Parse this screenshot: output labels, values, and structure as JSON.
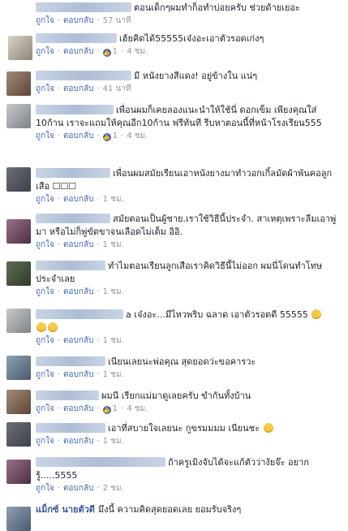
{
  "comments": [
    {
      "text": "ตอนเด็กๆผมทำก็อทำบ่อยครับ ช่วยด้ายเยอะ",
      "like": "ถูกใจ",
      "reply": "ตอบกลับ",
      "reactions": "",
      "time": "57 นาที"
    },
    {
      "text": "เฮ้ยคิดได้55555เจ๋งอะเอาตัวรอดเก่งๆ",
      "like": "ถูกใจ",
      "reply": "ตอบกลับ",
      "reactions": "1",
      "time": "4 ชม."
    },
    {
      "text": "มี หนังยางสีแดง! อยู่ข้างใน แน่ๆ",
      "like": "ถูกใจ",
      "reply": "ตอบกลับ",
      "reactions": "",
      "time": "41 นาที"
    },
    {
      "text": "เพื่อนผมก็เคยลองแนะนำให้ใช้นี่ ดอกเข็ม เพียงคุณใส่ 10ก้าน เราจะแถมให้คุณอีก10ก้าน ฟรีทันที รีบหาตอนนี้ที่หน้าโรงเรียน555",
      "like": "ถูกใจ",
      "reply": "ตอบกลับ",
      "reactions": "1",
      "time": "4 ชม."
    },
    {
      "text": "เพื่อนผมสมัยเรียนเอาหนังยางมาทำวอกเกิ้ลมัดผ้าพันคอลูกเสือ ☐☐☐",
      "like": "ถูกใจ",
      "reply": "ตอบกลับ",
      "reactions": "",
      "time": "1 ชม."
    },
    {
      "text": "สมัยตอนเป็นผู้ชาย.เราใช้วิธีนี้ประจำ. สาเหตุเพราะลืมเอาพู่มา หรือไม่ก็พู่ขัดขาจนเลือดไม่เต็ม อิอิ.",
      "like": "ถูกใจ",
      "reply": "ตอบกลับ",
      "reactions": "",
      "time": "1 ชม."
    },
    {
      "text": "ทำไมตอนเรียนลูกเสือเราคิดวิธีนี้ไม่ออก ผมนี่โดนทำโทษประจำเลย",
      "like": "ถูกใจ",
      "reply": "ตอบกลับ",
      "reactions": "",
      "time": "1 ชม."
    },
    {
      "text": "a เจ๋งอะ...มีไหวพริบ ฉลาด เอาตัวรอดดี 55555",
      "like": "ถูกใจ",
      "reply": "ตอบกลับ",
      "reactions": "",
      "time": "1 ชม."
    },
    {
      "text": "เนียนเลยนะพ่อคุณ สุดยอดว่ะขอคารวะ",
      "like": "ถูกใจ",
      "reply": "ตอบกลับ",
      "reactions": "",
      "time": "1 ชม."
    },
    {
      "text": "ผมนี เรียกแม่มาดูเลยครับ ขำกันทั้งบ้าน",
      "like": "ถูกใจ",
      "reply": "ตอบกลับ",
      "reactions": "1",
      "time": "4 ชม."
    },
    {
      "text": "เอาที่สบายใจเลยนะ กูขรมมมม เนียนชะ",
      "like": "ถูกใจ",
      "reply": "ตอบกลับ",
      "reactions": "",
      "time": "1 ชม."
    },
    {
      "text": "ถ้าครูเมิงจับได้จะแก้ตัวว่างัยจ๊ะ อยากรู้.....5555",
      "like": "ถูกใจ",
      "reply": "ตอบกลับ",
      "reactions": "",
      "time": "2 ชม."
    },
    {
      "name": "แม็กซ์ นายตัวดี",
      "text": "มึงนี้ ความคิดสุดยอดเลย ยอมรับจริงๆ",
      "like": "",
      "reply": "",
      "reactions": "",
      "time": ""
    }
  ]
}
